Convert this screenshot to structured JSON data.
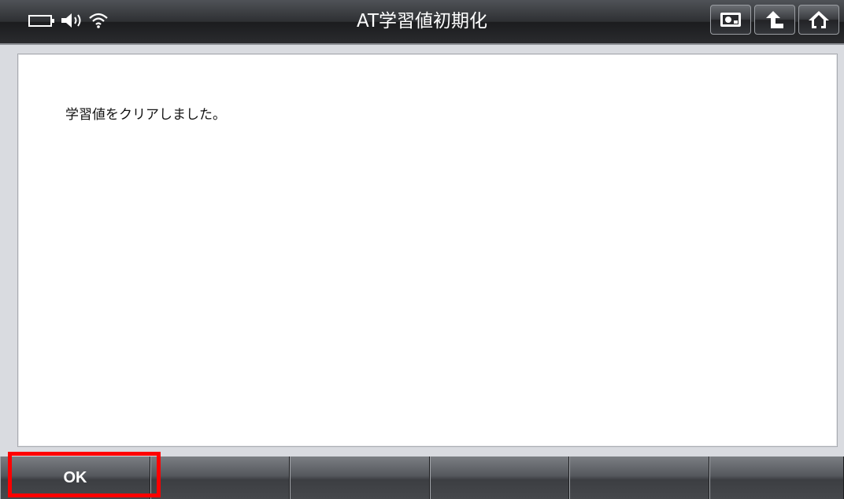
{
  "header": {
    "title": "AT学習値初期化",
    "status_icons": [
      "battery-icon",
      "speaker-icon",
      "wifi-icon"
    ],
    "nav_buttons": [
      "screenshot-icon",
      "back-arrow-icon",
      "home-icon"
    ]
  },
  "main": {
    "message": "学習値をクリアしました。"
  },
  "softkeys": [
    {
      "label": "OK"
    },
    {
      "label": ""
    },
    {
      "label": ""
    },
    {
      "label": ""
    },
    {
      "label": ""
    },
    {
      "label": ""
    }
  ],
  "colors": {
    "highlight": "#ff0000",
    "titlebar": "#2e3033"
  }
}
